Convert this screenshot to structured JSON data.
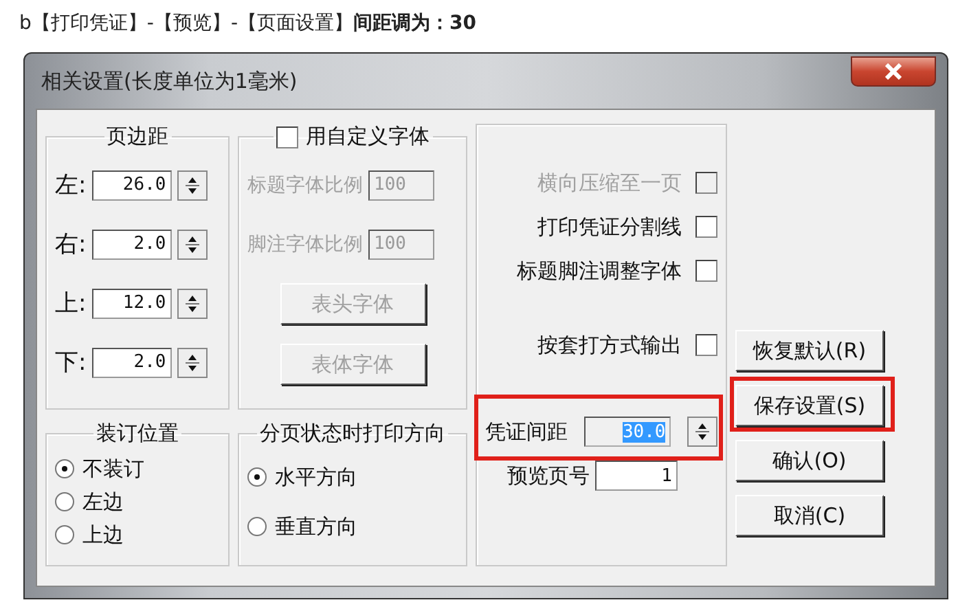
{
  "caption": "b【打印凭证】-【预览】-【页面设置】**间距调为：30**",
  "window": {
    "title": "相关设置(长度单位为1毫米)"
  },
  "margins": {
    "title": "页边距",
    "fields": [
      {
        "label": "左:",
        "value": "26.0"
      },
      {
        "label": "右:",
        "value": "2.0"
      },
      {
        "label": "上:",
        "value": "12.0"
      },
      {
        "label": "下:",
        "value": "2.0"
      }
    ]
  },
  "custom_font": {
    "label": "用自定义字体",
    "checked": false,
    "fields": [
      {
        "label": "标题字体比例",
        "value": "100",
        "disabled": true
      },
      {
        "label": "脚注字体比例",
        "value": "100",
        "disabled": true
      }
    ],
    "buttons": [
      {
        "label": "表头字体",
        "disabled": true
      },
      {
        "label": "表体字体",
        "disabled": true
      }
    ]
  },
  "options": [
    {
      "label": "横向压缩至一页",
      "checked": false,
      "disabled": true
    },
    {
      "label": "打印凭证分割线",
      "checked": false,
      "disabled": false
    },
    {
      "label": "标题脚注调整字体",
      "checked": false,
      "disabled": false
    },
    {
      "label": "按套打方式输出",
      "checked": false,
      "disabled": false
    }
  ],
  "voucher_spacing": {
    "label": "凭证间距",
    "value": "30.0",
    "text_selected": true,
    "annotated": true
  },
  "preview_page": {
    "label": "预览页号",
    "value": "1"
  },
  "buttons": [
    {
      "label": "恢复默认(R)",
      "annotated": false
    },
    {
      "label": "保存设置(S)",
      "annotated": true
    },
    {
      "label": "确认(O)",
      "annotated": false
    },
    {
      "label": "取消(C)",
      "annotated": false
    }
  ],
  "binding": {
    "title": "装订位置",
    "options": [
      {
        "label": "不装订",
        "selected": true
      },
      {
        "label": "左边",
        "selected": false
      },
      {
        "label": "上边",
        "selected": false
      }
    ]
  },
  "direction": {
    "title": "分页状态时打印方向",
    "options": [
      {
        "label": "水平方向",
        "selected": true
      },
      {
        "label": "垂直方向",
        "selected": false
      }
    ]
  }
}
